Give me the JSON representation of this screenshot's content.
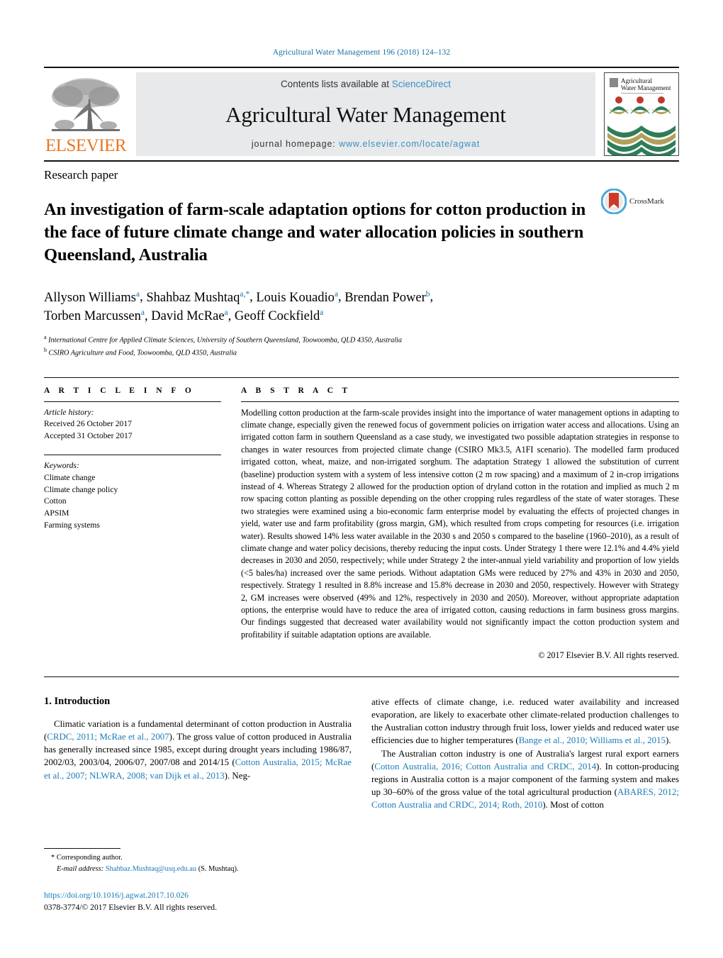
{
  "running_head": "Agricultural Water Management 196 (2018) 124–132",
  "masthead": {
    "publisher_name": "ELSEVIER",
    "contents_prefix": "Contents lists available at ",
    "sciencedirect": "ScienceDirect",
    "journal_title": "Agricultural Water Management",
    "homepage_prefix": "journal homepage: ",
    "homepage_url": "www.elsevier.com/locate/agwat",
    "cover_title_line1": "Agricultural",
    "cover_title_line2": "Water Management"
  },
  "article": {
    "type": "Research paper",
    "title": "An investigation of farm-scale adaptation options for cotton production in the face of future climate change and water allocation policies in southern Queensland, Australia",
    "crossmark_label": "CrossMark",
    "authors_line1": "Allyson Williams",
    "authors_line2": "Torben Marcussen",
    "affiliation_a": "International Centre for Applied Climate Sciences, University of Southern Queensland, Toowoomba, QLD 4350, Australia",
    "affiliation_b": "CSIRO Agriculture and Food, Toowoomba, QLD 4350, Australia"
  },
  "authors": [
    {
      "name": "Allyson Williams",
      "sup": "a"
    },
    {
      "name": "Shahbaz Mushtaq",
      "sup": "a,*"
    },
    {
      "name": "Louis Kouadio",
      "sup": "a"
    },
    {
      "name": "Brendan Power",
      "sup": "b"
    },
    {
      "name": "Torben Marcussen",
      "sup": "a"
    },
    {
      "name": "David McRae",
      "sup": "a"
    },
    {
      "name": "Geoff Cockfield",
      "sup": "a"
    }
  ],
  "article_info": {
    "heading": "A R T I C L E   I N F O",
    "history_label": "Article history:",
    "received": "Received 26 October 2017",
    "accepted": "Accepted 31 October 2017",
    "keywords_label": "Keywords:",
    "keywords": [
      "Climate change",
      "Climate change policy",
      "Cotton",
      "APSIM",
      "Farming systems"
    ]
  },
  "abstract": {
    "heading": "A B S T R A C T",
    "text": "Modelling cotton production at the farm-scale provides insight into the importance of water management options in adapting to climate change, especially given the renewed focus of government policies on irrigation water access and allocations. Using an irrigated cotton farm in southern Queensland as a case study, we investigated two possible adaptation strategies in response to changes in water resources from projected climate change (CSIRO Mk3.5, A1FI scenario). The modelled farm produced irrigated cotton, wheat, maize, and non-irrigated sorghum. The adaptation Strategy 1 allowed the substitution of current (baseline) production system with a system of less intensive cotton (2 m row spacing) and a maximum of 2 in-crop irrigations instead of 4. Whereas Strategy 2 allowed for the production option of dryland cotton in the rotation and implied as much 2 m row spacing cotton planting as possible depending on the other cropping rules regardless of the state of water storages. These two strategies were examined using a bio-economic farm enterprise model by evaluating the effects of projected changes in yield, water use and farm profitability (gross margin, GM), which resulted from crops competing for resources (i.e. irrigation water). Results showed 14% less water available in the 2030 s and 2050 s compared to the baseline (1960–2010), as a result of climate change and water policy decisions, thereby reducing the input costs. Under Strategy 1 there were 12.1% and 4.4% yield decreases in 2030 and 2050, respectively; while under Strategy 2 the inter-annual yield variability and proportion of low yields (<5 bales/ha) increased over the same periods. Without adaptation GMs were reduced by 27% and 43% in 2030 and 2050, respectively. Strategy 1 resulted in 8.8% increase and 15.8% decrease in 2030 and 2050, respectively. However with Strategy 2, GM increases were observed (49% and 12%, respectively in 2030 and 2050). Moreover, without appropriate adaptation options, the enterprise would have to reduce the area of irrigated cotton, causing reductions in farm business gross margins. Our findings suggested that decreased water availability would not significantly impact the cotton production system and profitability if suitable adaptation options are available.",
    "copyright": "© 2017 Elsevier B.V. All rights reserved."
  },
  "body": {
    "section_number_title": "1.  Introduction",
    "left_paragraph_1_parts": [
      {
        "t": "Climatic variation is a fundamental determinant of cotton production in Australia (",
        "ref": false
      },
      {
        "t": "CRDC, 2011; McRae et al., 2007",
        "ref": true
      },
      {
        "t": "). The gross value of cotton produced in Australia has generally increased since 1985, except during drought years including 1986/87, 2002/03, 2003/04, 2006/07, 2007/08 and 2014/15 (",
        "ref": false
      },
      {
        "t": "Cotton Australia, 2015; McRae et al., 2007; NLWRA, 2008; van Dijk et al., 2013",
        "ref": true
      },
      {
        "t": "). Neg-",
        "ref": false
      }
    ],
    "right_paragraph_1_parts": [
      {
        "t": "ative effects of climate change, i.e. reduced water availability and increased evaporation, are likely to exacerbate other climate-related production challenges to the Australian cotton industry through fruit loss, lower yields and reduced water use efficiencies due to higher temperatures (",
        "ref": false
      },
      {
        "t": "Bange et al., 2010; Williams et al., 2015",
        "ref": true
      },
      {
        "t": ").",
        "ref": false
      }
    ],
    "right_paragraph_2_parts": [
      {
        "t": "The Australian cotton industry is one of Australia's largest rural export earners (",
        "ref": false
      },
      {
        "t": "Cotton Australia, 2016; Cotton Australia and CRDC, 2014",
        "ref": true
      },
      {
        "t": "). In cotton-producing regions in Australia cotton is a major component of the farming system and makes up 30–60% of the gross value of the total agricultural production (",
        "ref": false
      },
      {
        "t": "ABARES, 2012; Cotton Australia and CRDC, 2014; Roth, 2010",
        "ref": true
      },
      {
        "t": "). Most of cotton",
        "ref": false
      }
    ]
  },
  "footnote": {
    "star": "*",
    "corresponding": "Corresponding author.",
    "email_label": "E-mail address:",
    "email": "Shahbaz.Mushtaq@usq.edu.au",
    "email_suffix": "(S. Mushtaq).",
    "doi": "https://doi.org/10.1016/j.agwat.2017.10.026",
    "issn": "0378-3774/© 2017 Elsevier B.V. All rights reserved."
  },
  "colors": {
    "link": "#1a7bb9",
    "running_head": "#1a6fa3",
    "elsevier_orange": "#E87722",
    "band_bg": "#e8e9ea",
    "cover_green": "#2f7d58",
    "cover_tan": "#b0a05a",
    "cover_red": "#c0392b",
    "crossmark_blue": "#4aa8d8",
    "crossmark_red": "#cc3b27"
  }
}
